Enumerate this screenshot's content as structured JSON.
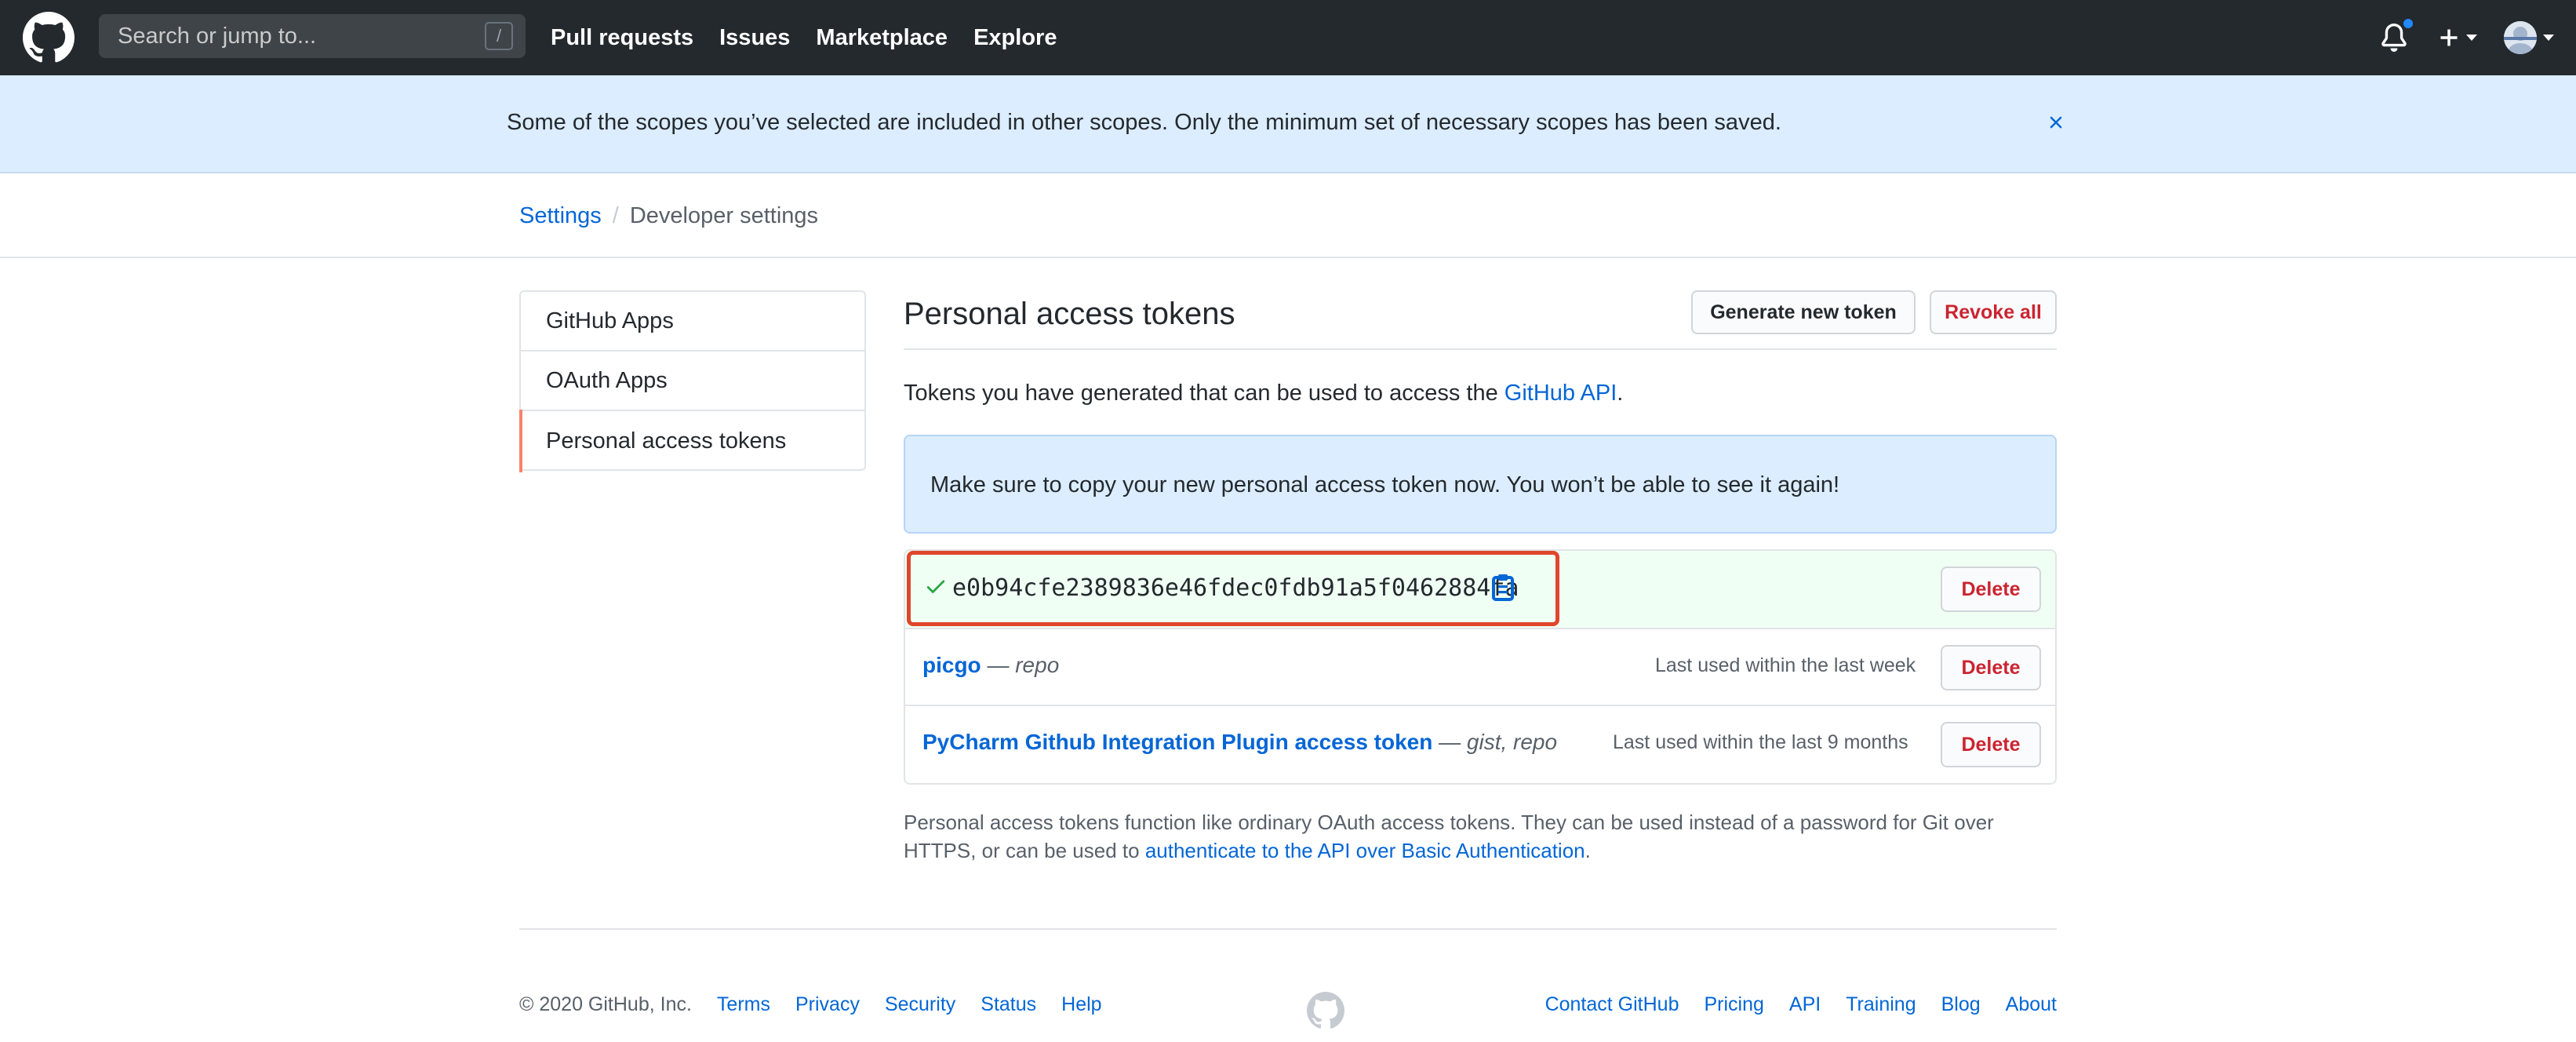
{
  "header": {
    "search_placeholder": "Search or jump to...",
    "search_shortcut": "/",
    "nav": [
      "Pull requests",
      "Issues",
      "Marketplace",
      "Explore"
    ]
  },
  "flash": {
    "message": "Some of the scopes you’ve selected are included in other scopes. Only the minimum set of necessary scopes has been saved."
  },
  "breadcrumb": {
    "root": "Settings",
    "separator": "/",
    "current": "Developer settings"
  },
  "sidebar": {
    "items": [
      {
        "label": "GitHub Apps"
      },
      {
        "label": "OAuth Apps"
      },
      {
        "label": "Personal access tokens"
      }
    ]
  },
  "main": {
    "title": "Personal access tokens",
    "generate_button": "Generate new token",
    "revoke_button": "Revoke all",
    "intro_text": "Tokens you have generated that can be used to access the ",
    "intro_link": "GitHub API",
    "intro_end": ".",
    "notice": "Make sure to copy your new personal access token now. You won’t be able to see it again!",
    "new_token": {
      "value": "e0b94cfe2389836e46fdec0fdb91a5f0462884fa",
      "delete_label": "Delete"
    },
    "tokens": [
      {
        "name": "picgo",
        "dash": " — ",
        "scopes": "repo",
        "last_used": "Last used within the last week",
        "delete_label": "Delete"
      },
      {
        "name": "PyCharm Github Integration Plugin access token",
        "dash": " — ",
        "scopes": "gist, repo",
        "last_used": "Last used within the last 9 months",
        "delete_label": "Delete"
      }
    ],
    "footnote_text": "Personal access tokens function like ordinary OAuth access tokens. They can be used instead of a password for Git over HTTPS, or can be used to ",
    "footnote_link": "authenticate to the API over Basic Authentication",
    "footnote_end": "."
  },
  "footer": {
    "copyright": "© 2020 GitHub, Inc.",
    "left_links": [
      "Terms",
      "Privacy",
      "Security",
      "Status",
      "Help"
    ],
    "right_links": [
      "Contact GitHub",
      "Pricing",
      "API",
      "Training",
      "Blog",
      "About"
    ]
  },
  "colors": {
    "header_bg": "#24292e",
    "flash_bg": "#dbedff",
    "link": "#0366d6",
    "danger": "#cb2431",
    "highlight_border": "#e0462b",
    "selected_marker": "#f9826c",
    "new_token_bg": "#f0fff4"
  }
}
